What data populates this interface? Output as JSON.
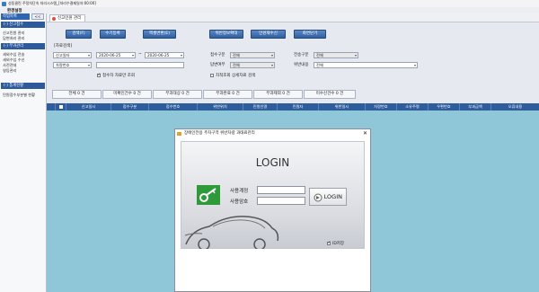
{
  "window": {
    "title": "성동클린 주정차단속 처리시스템_[처리수결제일자:00:00]",
    "menu": "환경설정"
  },
  "sidebar": {
    "top_label": "작업목록",
    "toggle": "<<",
    "sections": [
      {
        "header": "(-) 신고접수",
        "items": [
          "신고민원 관리",
          "답변처리 관리"
        ]
      },
      {
        "header": "(-) 부과관리",
        "items": [
          "세외수입 전송",
          "세외수입 수신",
          "사전전데",
          "영등관리"
        ]
      },
      {
        "header": "(-) 통계현황",
        "items": [
          "민원접수부분별 현황"
        ]
      }
    ]
  },
  "tab": {
    "label": "신고민원 관리"
  },
  "toolbar": {
    "search": "검색(F)",
    "manual": "수기등록",
    "excel": "엑셀변환(E)",
    "view_violation": "위반정보확대",
    "reset_complaint": "민원재수신",
    "close": "화면닫기"
  },
  "search": {
    "section_label": "[자료검색]",
    "date_type": "신고일자",
    "date_from": "2020-06-25",
    "date_to": "2020-06-25",
    "tilde": "~",
    "receipt_type_label": "접수구분",
    "receipt_type_value": "전체",
    "transfer_type_label": "전송구분",
    "transfer_type_value": "전체",
    "vehicle_type": "차량번호",
    "reply_label": "답변여부",
    "reply_value": "전체",
    "violation_label": "위반내용",
    "violation_value": "전체",
    "receipt_only": "접수자 자료만 조회",
    "exact_search": "차적조회 상세자료 검색"
  },
  "summary": [
    "전체 0 건",
    "미확인건수 0 건",
    "부과대상 0 건",
    "부과완료 0 건",
    "부과제외 0 건",
    "미수신건수 0 건"
  ],
  "grid": {
    "columns": [
      "",
      "",
      "신고일시",
      "접수구분",
      "접수번호",
      "위반위치",
      "민원인명",
      "민원자",
      "위반일시",
      "차량번호",
      "소유주명",
      "우편번호",
      "부과금액",
      "오류내용"
    ]
  },
  "dialog": {
    "title": "장애인전용 주차구역 위반차량 과태료관리",
    "login_title": "LOGIN",
    "user_id_label": "사용계정",
    "password_label": "사용암호",
    "login_button": "LOGIN",
    "id_save": "ID저장",
    "close": "✕"
  }
}
